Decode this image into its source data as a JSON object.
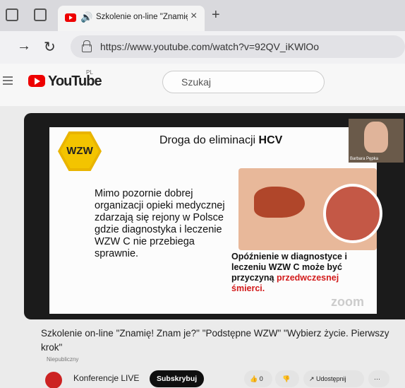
{
  "browser": {
    "tab_title": "Szkolenie on-line \"Znamię!",
    "tab_close": "×",
    "new_tab": "+",
    "url": "https://www.youtube.com/watch?v=92QV_iKWlOo"
  },
  "youtube": {
    "logo": "YouTube",
    "region": "PL",
    "search_placeholder": "Szukaj"
  },
  "slide": {
    "badge": "WZW",
    "title_prefix": "Droga do eliminacji ",
    "title_bold": "HCV",
    "body": "Mimo pozornie dobrej organizacji opieki medycznej zdarzają się rejony w Polsce gdzie diagnostyka i leczenie WZW C nie przebiega sprawnie.",
    "callout_black": "Opóźnienie w diagnostyce i leczeniu WZW C może być przyczyną",
    "callout_red": "przedwczesnej śmierci.",
    "watermark": "zoom",
    "speaker": "Barbara Pępka"
  },
  "video": {
    "title": "Szkolenie on-line \"Znamię! Znam je?\" \"Podstępne WZW\" \"Wybierz życie. Pierwszy krok\"",
    "visibility": "Niepubliczny",
    "channel": "Konferencje LIVE",
    "subscribe": "Subskrybuj",
    "likes": "0",
    "share": "Udostępnij",
    "more": "···"
  }
}
